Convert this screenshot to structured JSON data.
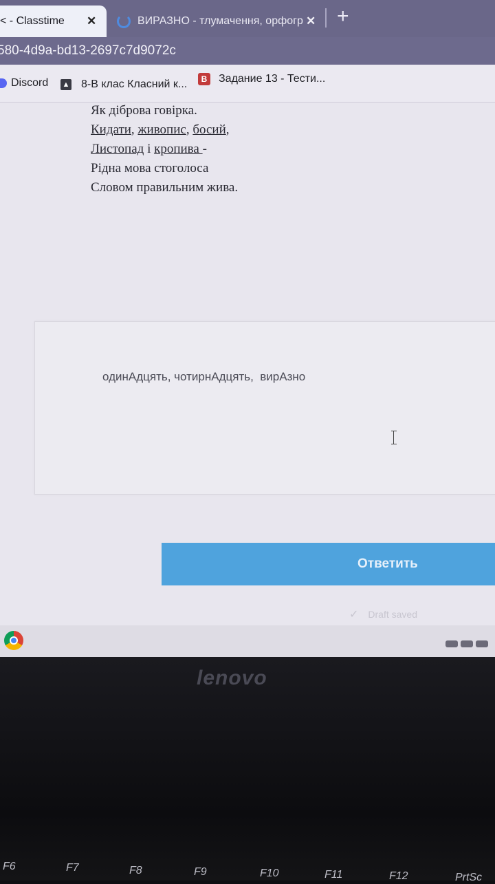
{
  "browser": {
    "tabs": [
      {
        "title": "< - Classtime",
        "close": "✕",
        "active": true
      },
      {
        "title": "ВИРАЗНО - тлумачення, орфогр",
        "close": "✕",
        "active": false
      }
    ],
    "new_tab": "+",
    "url": "580-4d9a-bd13-2697c7d9072c",
    "bookmarks": [
      {
        "label": "Discord"
      },
      {
        "label": "8-В клас Класний к..."
      },
      {
        "label": "Задание 13 - Тести...",
        "icon_letter": "В"
      }
    ]
  },
  "poem": {
    "lines": [
      "Як діброва говірка.",
      "Кидати, живопис, босий,",
      "Листопад і кропива -",
      "Рідна мова стоголоса",
      "Словом правильним жива."
    ],
    "line2_parts": [
      "Кидати",
      ", ",
      "живопис",
      ", ",
      "босий",
      ","
    ],
    "line3_parts": [
      "Листопад",
      " і ",
      "кропива ",
      "-"
    ]
  },
  "answer": {
    "text": "одинАдцять, чотирнАдцять,  вирАзно"
  },
  "submit": {
    "label": "Ответить"
  },
  "draft": {
    "label": "Draft saved",
    "icon": "check-icon"
  },
  "laptop": {
    "brand": "lenovo",
    "fkeys": [
      "F6",
      "F7",
      "F8",
      "F9",
      "F10",
      "F11",
      "F12",
      "PrtSc"
    ]
  },
  "colors": {
    "accent_button": "#4fa3dd",
    "tab_strip": "#6a6789"
  }
}
